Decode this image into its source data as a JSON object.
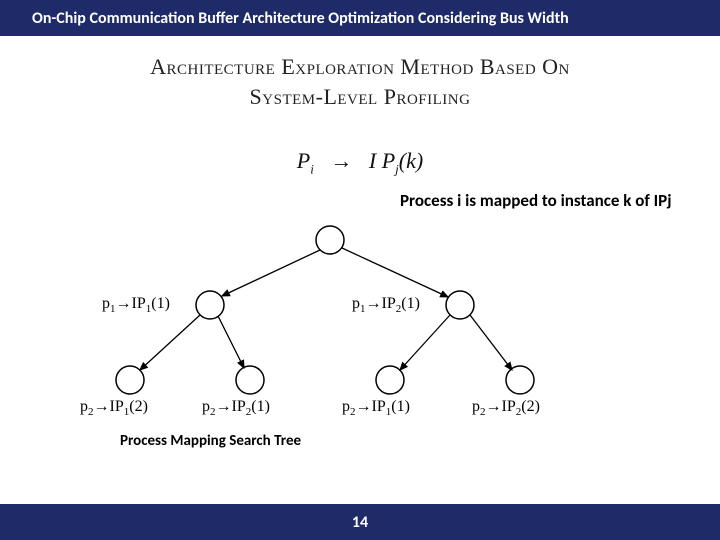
{
  "header": {
    "title": "On-Chip Communication Buffer Architecture Optimization Considering Bus Width"
  },
  "section": {
    "line1": "Architecture Exploration Method Based On",
    "line2": "System-Level Profiling"
  },
  "notation": {
    "lhs_base": "P",
    "lhs_sub": "i",
    "arrow": "→",
    "rhs_base": "I P",
    "rhs_sub": "j",
    "rhs_arg": "(k)"
  },
  "note": "Process i is mapped to instance k of IPj",
  "tree": {
    "caption": "Process Mapping Search Tree",
    "labels": {
      "l1a": {
        "p": "p",
        "ps": "1",
        "ip": "IP",
        "ips": "1",
        "arg": "(1)"
      },
      "l1b": {
        "p": "p",
        "ps": "1",
        "ip": "IP",
        "ips": "2",
        "arg": "(1)"
      },
      "l2a": {
        "p": "p",
        "ps": "2",
        "ip": "IP",
        "ips": "1",
        "arg": "(2)"
      },
      "l2b": {
        "p": "p",
        "ps": "2",
        "ip": "IP",
        "ips": "2",
        "arg": "(1)"
      },
      "l2c": {
        "p": "p",
        "ps": "2",
        "ip": "IP",
        "ips": "1",
        "arg": "(1)"
      },
      "l2d": {
        "p": "p",
        "ps": "2",
        "ip": "IP",
        "ips": "2",
        "arg": "(2)"
      }
    }
  },
  "footer": {
    "page": "14"
  }
}
